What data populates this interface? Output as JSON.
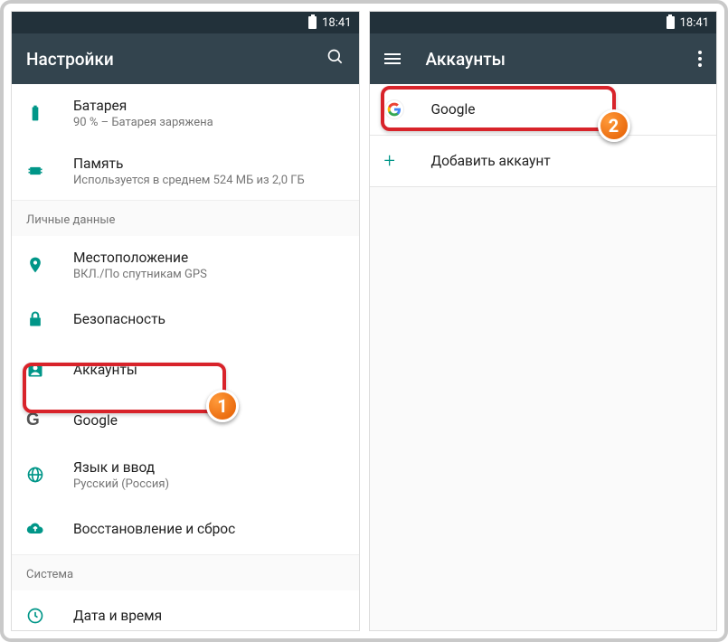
{
  "status_time": "18:41",
  "left": {
    "title": "Настройки",
    "items": {
      "battery": {
        "primary": "Батарея",
        "secondary": "90 % – Батарея заряжена"
      },
      "memory": {
        "primary": "Память",
        "secondary": "Используется в среднем 524 МБ из 2,0 ГБ"
      },
      "subheader_personal": "Личные данные",
      "location": {
        "primary": "Местоположение",
        "secondary": "ВКЛ./По спутникам GPS"
      },
      "security": {
        "primary": "Безопасность"
      },
      "accounts": {
        "primary": "Аккаунты"
      },
      "google": {
        "primary": "Google"
      },
      "lang": {
        "primary": "Язык и ввод",
        "secondary": "Русский (Россия)"
      },
      "backup": {
        "primary": "Восстановление и сброс"
      },
      "subheader_system": "Система",
      "datetime": {
        "primary": "Дата и время"
      }
    }
  },
  "right": {
    "title": "Аккаунты",
    "items": {
      "google": {
        "primary": "Google"
      },
      "add": {
        "primary": "Добавить аккаунт"
      }
    }
  },
  "annotations": {
    "step1": "1",
    "step2": "2"
  }
}
